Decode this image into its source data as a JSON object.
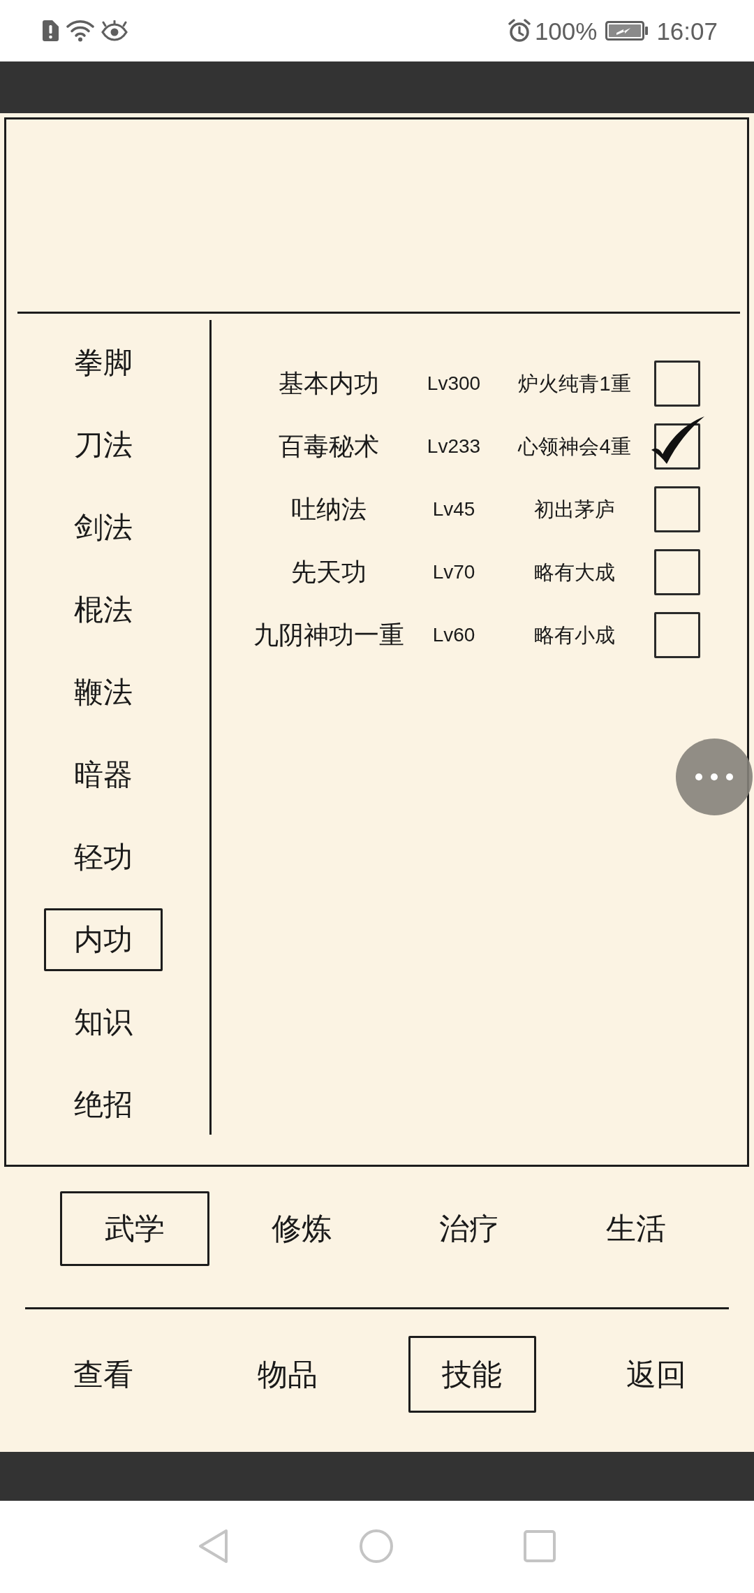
{
  "status_bar": {
    "battery": "100%",
    "time": "16:07"
  },
  "categories": [
    {
      "label": "拳脚",
      "selected": false
    },
    {
      "label": "刀法",
      "selected": false
    },
    {
      "label": "剑法",
      "selected": false
    },
    {
      "label": "棍法",
      "selected": false
    },
    {
      "label": "鞭法",
      "selected": false
    },
    {
      "label": "暗器",
      "selected": false
    },
    {
      "label": "轻功",
      "selected": false
    },
    {
      "label": "内功",
      "selected": true
    },
    {
      "label": "知识",
      "selected": false
    },
    {
      "label": "绝招",
      "selected": false
    }
  ],
  "skills": [
    {
      "name": "基本内功",
      "lv": "Lv300",
      "realm": "炉火纯青1重",
      "checked": false
    },
    {
      "name": "百毒秘术",
      "lv": "Lv233",
      "realm": "心领神会4重",
      "checked": true
    },
    {
      "name": "吐纳法",
      "lv": "Lv45",
      "realm": "初出茅庐",
      "checked": false
    },
    {
      "name": "先天功",
      "lv": "Lv70",
      "realm": "略有大成",
      "checked": false
    },
    {
      "name": "九阴神功一重",
      "lv": "Lv60",
      "realm": "略有小成",
      "checked": false
    }
  ],
  "tabs": [
    {
      "label": "武学",
      "selected": true
    },
    {
      "label": "修炼",
      "selected": false
    },
    {
      "label": "治疗",
      "selected": false
    },
    {
      "label": "生活",
      "selected": false
    }
  ],
  "bottom_menu": [
    {
      "label": "查看",
      "selected": false
    },
    {
      "label": "物品",
      "selected": false
    },
    {
      "label": "技能",
      "selected": true
    },
    {
      "label": "返回",
      "selected": false
    }
  ]
}
